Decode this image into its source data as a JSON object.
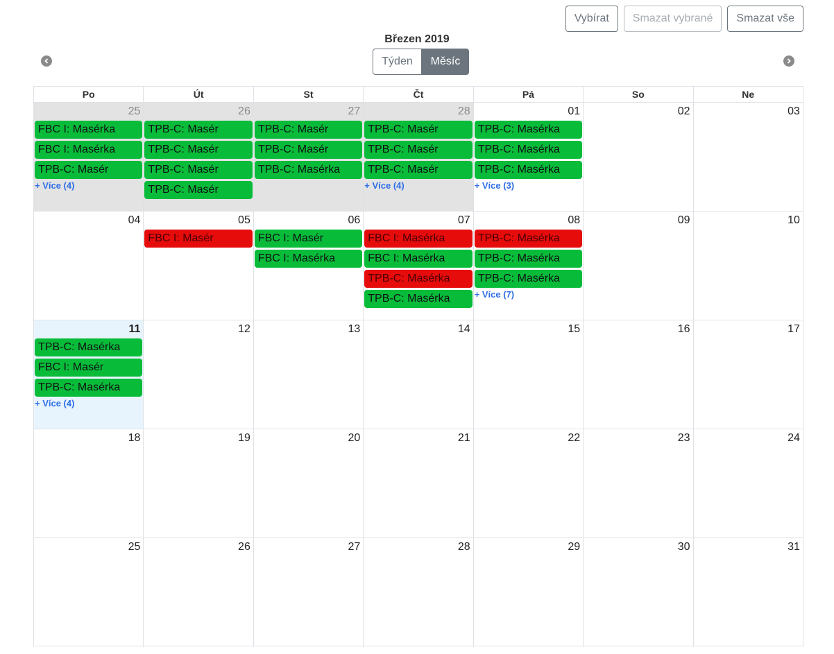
{
  "actions": {
    "select": "Vybírat",
    "delete_selected": "Smazat vybrané",
    "delete_all": "Smazat vše"
  },
  "header": {
    "title": "Březen 2019",
    "views": [
      "Týden",
      "Měsíc"
    ],
    "active_view": "Měsíc"
  },
  "weekdays": [
    "Po",
    "Út",
    "St",
    "Čt",
    "Pá",
    "So",
    "Ne"
  ],
  "colors": {
    "green": "#08bc3a",
    "red": "#e60c0c",
    "link": "#2e6ee6",
    "today": "#e8f4fd",
    "other_month": "#e3e3e3"
  },
  "weeks": [
    [
      {
        "d": "25",
        "other": true,
        "events": [
          {
            "t": "FBC I: Masérka",
            "c": "green"
          },
          {
            "t": "FBC I: Masérka",
            "c": "green"
          },
          {
            "t": "TPB-C: Masér",
            "c": "green"
          }
        ],
        "more": "+ Více (4)"
      },
      {
        "d": "26",
        "other": true,
        "events": [
          {
            "t": "TPB-C: Masér",
            "c": "green"
          },
          {
            "t": "TPB-C: Masér",
            "c": "green"
          },
          {
            "t": "TPB-C: Masér",
            "c": "green"
          },
          {
            "t": "TPB-C: Masér",
            "c": "green"
          }
        ]
      },
      {
        "d": "27",
        "other": true,
        "events": [
          {
            "t": "TPB-C: Masér",
            "c": "green"
          },
          {
            "t": "TPB-C: Masér",
            "c": "green"
          },
          {
            "t": "TPB-C: Masérka",
            "c": "green"
          }
        ]
      },
      {
        "d": "28",
        "other": true,
        "events": [
          {
            "t": "TPB-C: Masér",
            "c": "green"
          },
          {
            "t": "TPB-C: Masér",
            "c": "green"
          },
          {
            "t": "TPB-C: Masér",
            "c": "green"
          }
        ],
        "more": "+ Více (4)"
      },
      {
        "d": "01",
        "events": [
          {
            "t": "TPB-C: Masérka",
            "c": "green"
          },
          {
            "t": "TPB-C: Masérka",
            "c": "green"
          },
          {
            "t": "TPB-C: Masérka",
            "c": "green"
          }
        ],
        "more": "+ Více (3)"
      },
      {
        "d": "02",
        "events": []
      },
      {
        "d": "03",
        "events": []
      }
    ],
    [
      {
        "d": "04",
        "events": []
      },
      {
        "d": "05",
        "events": [
          {
            "t": "FBC I: Masér",
            "c": "red"
          }
        ]
      },
      {
        "d": "06",
        "events": [
          {
            "t": "FBC I: Masér",
            "c": "green"
          },
          {
            "t": "FBC I: Masérka",
            "c": "green"
          }
        ]
      },
      {
        "d": "07",
        "events": [
          {
            "t": "FBC I: Masérka",
            "c": "red"
          },
          {
            "t": "FBC I: Masérka",
            "c": "green"
          },
          {
            "t": "TPB-C: Masérka",
            "c": "red"
          },
          {
            "t": "TPB-C: Masérka",
            "c": "green"
          }
        ]
      },
      {
        "d": "08",
        "events": [
          {
            "t": "TPB-C: Masérka",
            "c": "red"
          },
          {
            "t": "TPB-C: Masérka",
            "c": "green"
          },
          {
            "t": "TPB-C: Masérka",
            "c": "green"
          }
        ],
        "more": "+ Více (7)"
      },
      {
        "d": "09",
        "events": []
      },
      {
        "d": "10",
        "events": []
      }
    ],
    [
      {
        "d": "11",
        "today": true,
        "events": [
          {
            "t": "TPB-C: Masérka",
            "c": "green"
          },
          {
            "t": "FBC I: Masér",
            "c": "green"
          },
          {
            "t": "TPB-C: Masérka",
            "c": "green"
          }
        ],
        "more": "+ Více (4)"
      },
      {
        "d": "12",
        "events": []
      },
      {
        "d": "13",
        "events": []
      },
      {
        "d": "14",
        "events": []
      },
      {
        "d": "15",
        "events": []
      },
      {
        "d": "16",
        "events": []
      },
      {
        "d": "17",
        "events": []
      }
    ],
    [
      {
        "d": "18",
        "events": []
      },
      {
        "d": "19",
        "events": []
      },
      {
        "d": "20",
        "events": []
      },
      {
        "d": "21",
        "events": []
      },
      {
        "d": "22",
        "events": []
      },
      {
        "d": "23",
        "events": []
      },
      {
        "d": "24",
        "events": []
      }
    ],
    [
      {
        "d": "25",
        "events": []
      },
      {
        "d": "26",
        "events": []
      },
      {
        "d": "27",
        "events": []
      },
      {
        "d": "28",
        "events": []
      },
      {
        "d": "29",
        "events": []
      },
      {
        "d": "30",
        "events": []
      },
      {
        "d": "31",
        "events": []
      }
    ]
  ]
}
